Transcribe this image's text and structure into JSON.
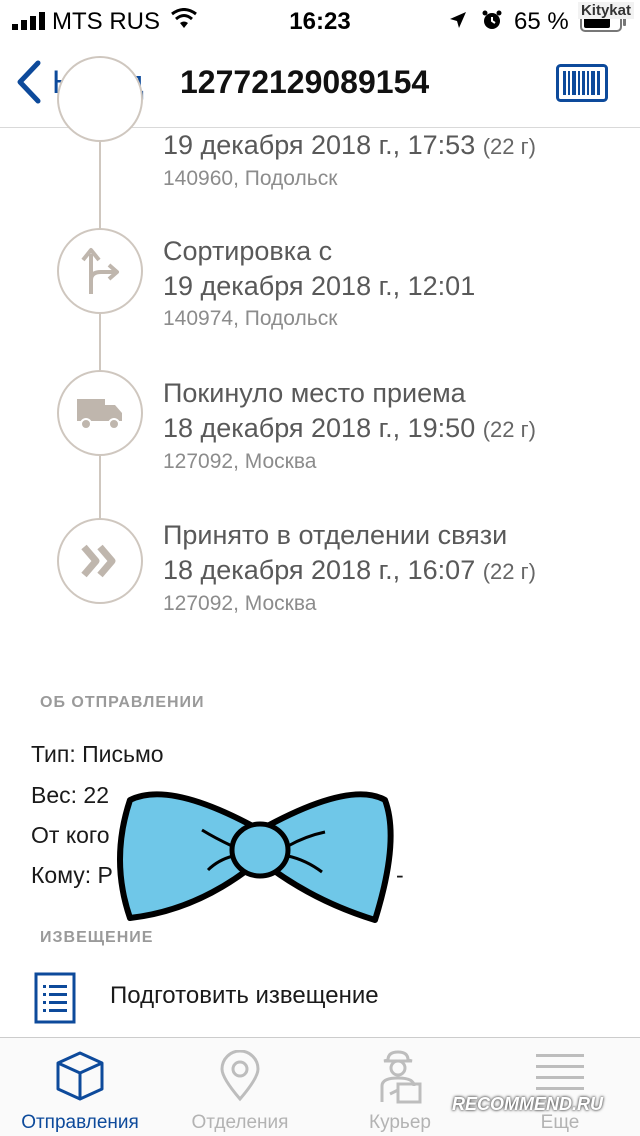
{
  "status_bar": {
    "carrier": "MTS RUS",
    "time": "16:23",
    "battery": "65 %",
    "watermark": "Kitykat"
  },
  "nav": {
    "back_label": "Назад",
    "title": "12772129089154"
  },
  "timeline": [
    {
      "title": "",
      "date": "19 декабря 2018 г., 17:53",
      "weight": "(22 г)",
      "place": "140960, Подольск",
      "icon": "partial-circle"
    },
    {
      "title": "Сортировка с",
      "date": "19 декабря 2018 г., 12:01",
      "weight": "",
      "place": "140974, Подольск",
      "icon": "sorting-arrow-icon"
    },
    {
      "title": "Покинуло место приема",
      "date": "18 декабря 2018 г., 19:50",
      "weight": "(22 г)",
      "place": "127092, Москва",
      "icon": "truck-icon"
    },
    {
      "title": "Принято в отделении связи",
      "date": "18 декабря 2018 г., 16:07",
      "weight": "(22 г)",
      "place": "127092, Москва",
      "icon": "double-chevron-icon"
    }
  ],
  "shipment": {
    "header": "ОБ ОТПРАВЛЕНИИ",
    "type": "Тип: Письмо",
    "weight": "Вес: 22",
    "from": "От кого",
    "to": "Кому: Р",
    "to_suffix": "-"
  },
  "notice": {
    "header": "ИЗВЕЩЕНИЕ",
    "action_label": "Подготовить извещение"
  },
  "tabs": [
    {
      "label": "Отправления",
      "icon": "package-icon",
      "active": true
    },
    {
      "label": "Отделения",
      "icon": "location-pin-icon",
      "active": false
    },
    {
      "label": "Курьер",
      "icon": "courier-icon",
      "active": false
    },
    {
      "label": "Еще",
      "icon": "menu-lines-icon",
      "active": false
    }
  ],
  "watermark_bottom": "RECOMMEND.RU",
  "colors": {
    "accent": "#0d4a9b",
    "timeline": "#cfc7bf",
    "bowtie": "#6fc7e8"
  }
}
